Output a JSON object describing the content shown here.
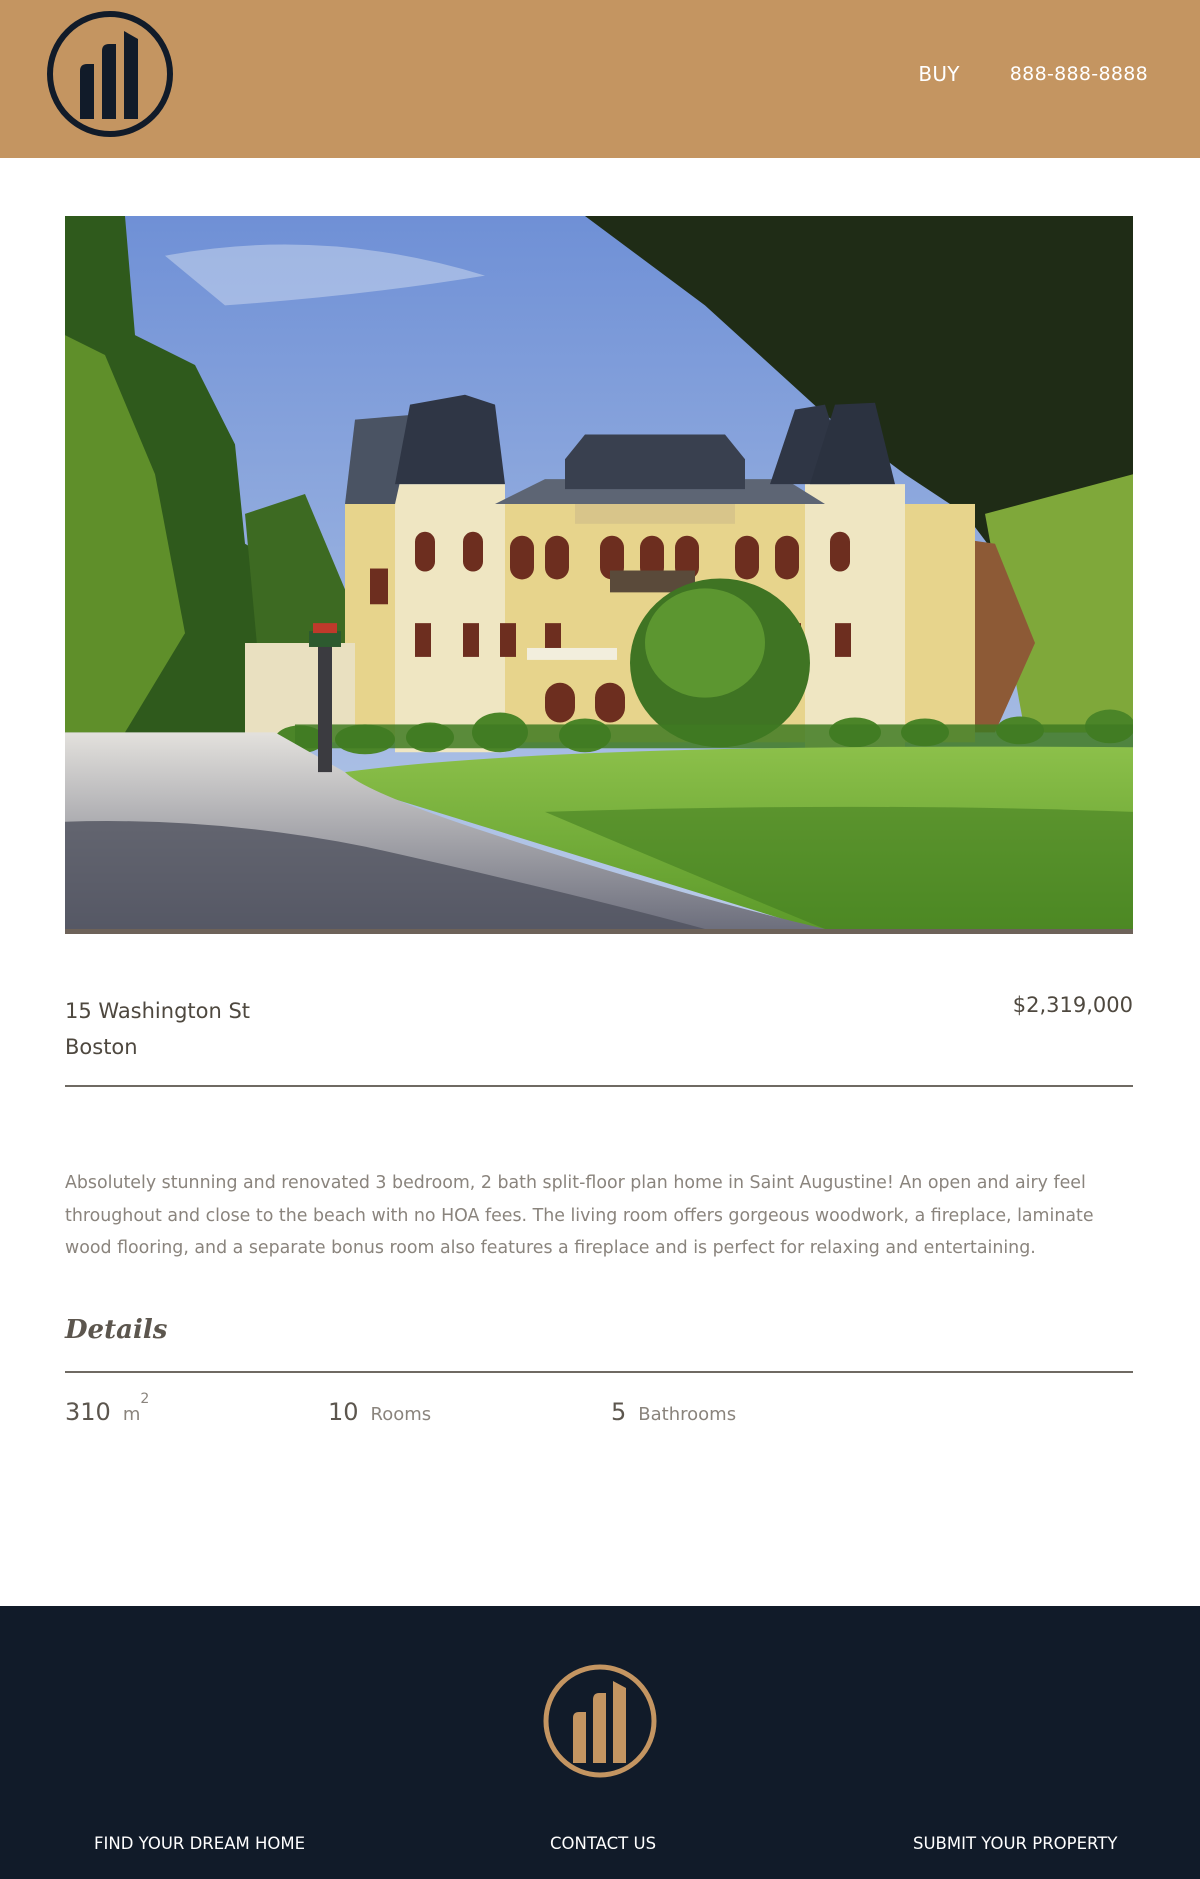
{
  "header": {
    "logo_icon": "building-circle-logo",
    "nav": {
      "buy_label": "BUY",
      "phone": "888-888-8888"
    },
    "colors": {
      "background": "#c49561",
      "logo": "#111b29"
    }
  },
  "listing": {
    "address_line1": "15 Washington St",
    "address_line2": "Boston",
    "price": "$2,319,000",
    "description": "Absolutely stunning and renovated 3 bedroom, 2 bath split-floor plan home in Saint Augustine! An open and airy feel throughout and close to the beach with no HOA fees. The living room offers gorgeous woodwork, a fireplace, laminate wood flooring, and a separate bonus room also features a fireplace and is perfect for relaxing and entertaining.",
    "details_title": "Details",
    "stats": {
      "area_value": "310",
      "area_unit": "m",
      "area_unit_sup": "2",
      "rooms_value": "10",
      "rooms_label": "Rooms",
      "baths_value": "5",
      "baths_label": "Bathrooms"
    }
  },
  "footer": {
    "logo_icon": "building-circle-logo",
    "links": {
      "find": "FIND YOUR DREAM HOME",
      "contact": "CONTACT US",
      "submit": "SUBMIT YOUR PROPERTY"
    },
    "colors": {
      "background": "#111b29",
      "logo": "#c49561"
    }
  }
}
